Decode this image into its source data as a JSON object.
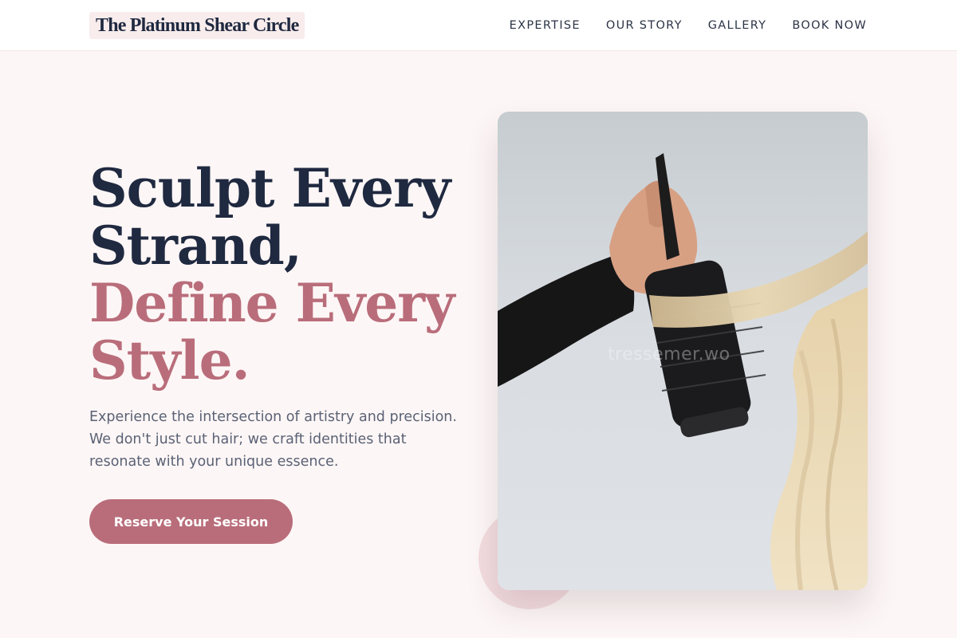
{
  "brand": {
    "name": "The Platinum Shear Circle"
  },
  "nav": {
    "items": [
      {
        "label": "EXPERTISE"
      },
      {
        "label": "OUR STORY"
      },
      {
        "label": "GALLERY"
      },
      {
        "label": "BOOK NOW"
      }
    ]
  },
  "hero": {
    "title_line1": "Sculpt Every",
    "title_line2": "Strand,",
    "title_line3": "Define Every",
    "title_line4": "Style.",
    "description": "Experience the intersection of artistry and precision. We don't just cut hair; we craft identities that resonate with your unique essence.",
    "cta_label": "Reserve Your Session"
  },
  "image": {
    "subject": "hand holding round brush through blonde hair",
    "watermark": "tressemer.wo"
  },
  "colors": {
    "accent": "#b96d7a",
    "heading": "#1f2940",
    "background": "#fdf6f6",
    "body_text": "#5a6275"
  }
}
